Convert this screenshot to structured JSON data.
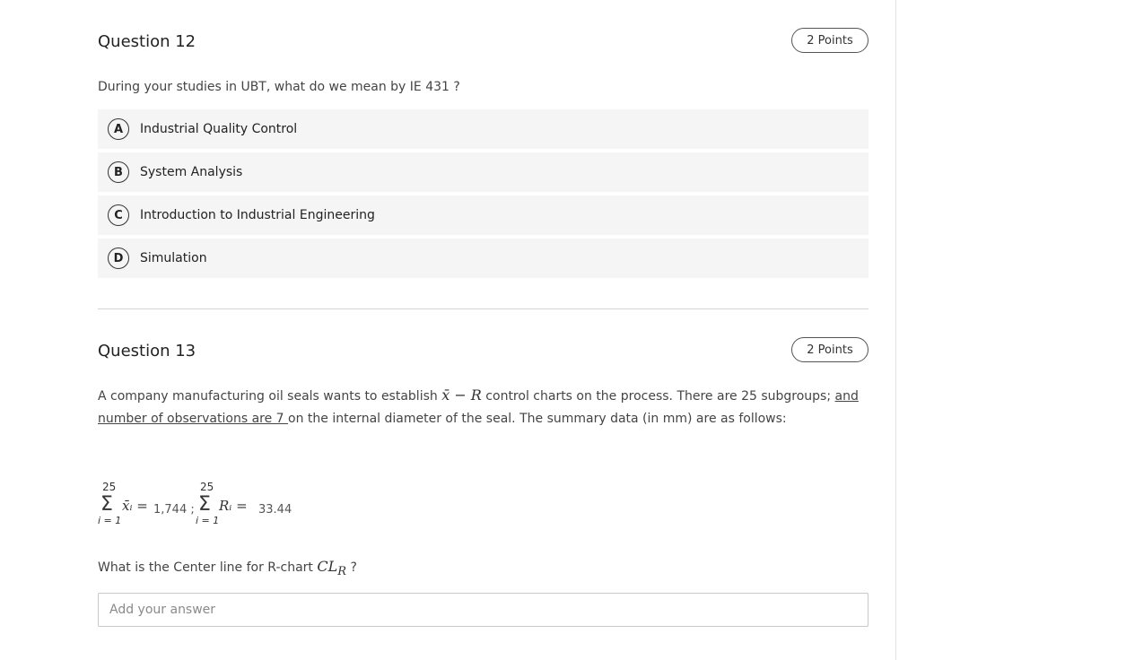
{
  "q12": {
    "title": "Question 12",
    "points": "2 Points",
    "prompt": "During your studies in UBT, what do we mean by IE 431 ?",
    "options": [
      {
        "letter": "A",
        "label": "Industrial Quality Control"
      },
      {
        "letter": "B",
        "label": "System Analysis"
      },
      {
        "letter": "C",
        "label": "Introduction to Industrial Engineering"
      },
      {
        "letter": "D",
        "label": "Simulation"
      }
    ]
  },
  "q13": {
    "title": "Question 13",
    "points": "2 Points",
    "para_part1": "A company manufacturing oil seals wants to establish ",
    "chart_symbol": "x̄ − R",
    "para_part2": " control charts on the process. There are 25 subgroups; ",
    "para_underlined": "and number of observations are 7 ",
    "para_part3": "on the internal diameter of the seal. The summary data (in mm) are as follows:",
    "sum1": {
      "upper": "25",
      "sigma": "Σ",
      "lower": "i = 1",
      "var": "x̄ᵢ =",
      "value": "1,744 ;"
    },
    "sum2": {
      "upper": "25",
      "sigma": "Σ",
      "lower": "i = 1",
      "var": "Rᵢ =",
      "value": "33.44"
    },
    "question_text": "What is the Center line for R-chart ",
    "question_symbol": "CL",
    "question_subscript": "R",
    "question_mark": " ?",
    "answer_placeholder": "Add your answer"
  }
}
